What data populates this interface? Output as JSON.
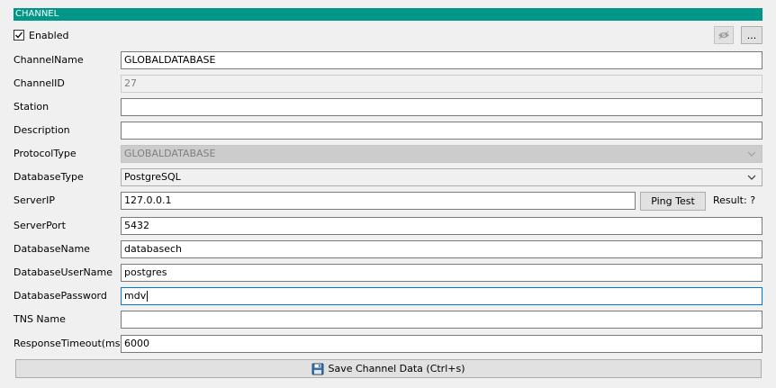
{
  "header": {
    "title": "CHANNEL"
  },
  "enabled": {
    "label": "Enabled",
    "checked": true
  },
  "toolbar": {
    "visibility_icon": "eye-icon",
    "more_label": "..."
  },
  "fields": {
    "channel_name": {
      "label": "ChannelName",
      "value": "GLOBALDATABASE"
    },
    "channel_id": {
      "label": "ChannelID",
      "value": "27"
    },
    "station": {
      "label": "Station",
      "value": ""
    },
    "description": {
      "label": "Description",
      "value": ""
    },
    "protocol_type": {
      "label": "ProtocolType",
      "value": "GLOBALDATABASE"
    },
    "database_type": {
      "label": "DatabaseType",
      "value": "PostgreSQL"
    },
    "server_ip": {
      "label": "ServerIP",
      "value": "127.0.0.1"
    },
    "server_port": {
      "label": "ServerPort",
      "value": "5432"
    },
    "database_name": {
      "label": "DatabaseName",
      "value": "databasech"
    },
    "database_user_name": {
      "label": "DatabaseUserName",
      "value": "postgres"
    },
    "database_password": {
      "label": "DatabasePassword",
      "value": "mdv"
    },
    "tns_name": {
      "label": "TNS Name",
      "value": ""
    },
    "response_timeout": {
      "label": "ResponseTimeout(ms)",
      "value": "6000"
    }
  },
  "ping": {
    "button_label": "Ping Test",
    "result_text": "Result: ?"
  },
  "save": {
    "label": "Save Channel Data (Ctrl+s)",
    "icon": "floppy-disk-icon"
  },
  "colors": {
    "header_bg": "#009688",
    "focus_border": "#0078d7"
  }
}
